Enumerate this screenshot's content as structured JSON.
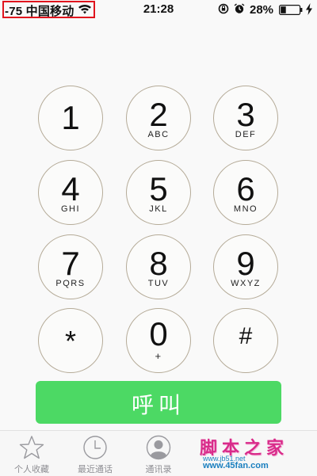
{
  "status_bar": {
    "carrier": "-75 中国移动",
    "time": "21:28",
    "battery_percent": "28%",
    "highlight_color": "#e0141e"
  },
  "keypad": {
    "keys": [
      {
        "digit": "1",
        "letters": ""
      },
      {
        "digit": "2",
        "letters": "ABC"
      },
      {
        "digit": "3",
        "letters": "DEF"
      },
      {
        "digit": "4",
        "letters": "GHI"
      },
      {
        "digit": "5",
        "letters": "JKL"
      },
      {
        "digit": "6",
        "letters": "MNO"
      },
      {
        "digit": "7",
        "letters": "PQRS"
      },
      {
        "digit": "8",
        "letters": "TUV"
      },
      {
        "digit": "9",
        "letters": "WXYZ"
      },
      {
        "digit": "*",
        "letters": ""
      },
      {
        "digit": "0",
        "letters": "+"
      },
      {
        "digit": "#",
        "letters": ""
      }
    ],
    "call_label": "呼叫",
    "call_color": "#4cd964"
  },
  "tab_bar": {
    "tabs": [
      {
        "label": "个人收藏",
        "icon": "star-icon"
      },
      {
        "label": "最近通话",
        "icon": "clock-icon"
      },
      {
        "label": "通讯录",
        "icon": "contact-icon"
      }
    ]
  },
  "watermark": {
    "title": "脚本之家",
    "url1": "www.jb51.net",
    "url2": "www.45fan.com"
  }
}
